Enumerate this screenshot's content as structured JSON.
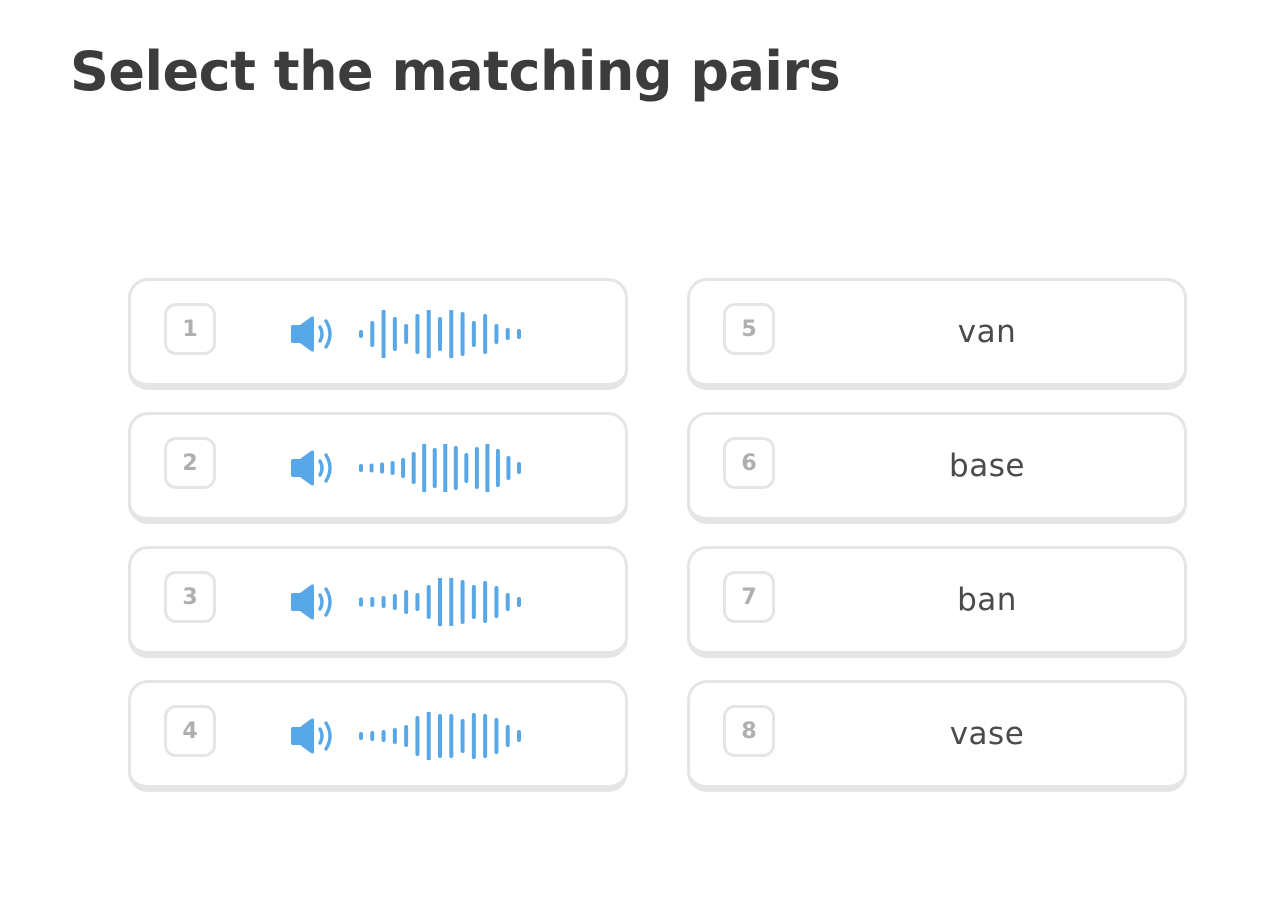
{
  "title": "Select the matching pairs",
  "accent_color": "#58a7e6",
  "border_color": "#e5e5e5",
  "audio_cards": [
    {
      "number": "1",
      "icon": "speaker-icon",
      "wave_icon": "waveform-icon"
    },
    {
      "number": "2",
      "icon": "speaker-icon",
      "wave_icon": "waveform-icon"
    },
    {
      "number": "3",
      "icon": "speaker-icon",
      "wave_icon": "waveform-icon"
    },
    {
      "number": "4",
      "icon": "speaker-icon",
      "wave_icon": "waveform-icon"
    }
  ],
  "word_cards": [
    {
      "number": "5",
      "word": "van"
    },
    {
      "number": "6",
      "word": "base"
    },
    {
      "number": "7",
      "word": "ban"
    },
    {
      "number": "8",
      "word": "vase"
    }
  ]
}
